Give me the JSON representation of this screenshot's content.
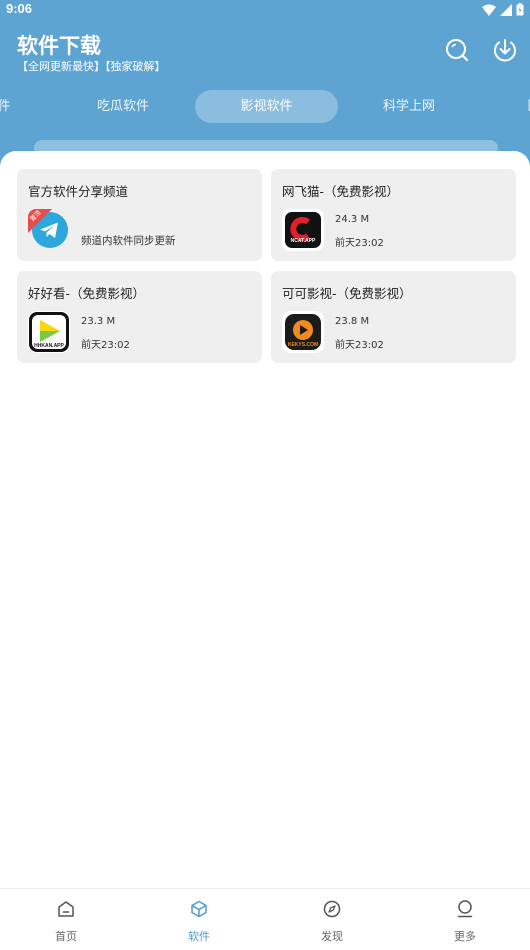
{
  "status_bar": {
    "time": "9:06"
  },
  "header": {
    "title": "软件下载",
    "subtitle": "【全网更新最快】【独家破解】"
  },
  "tabs": [
    {
      "label": "件"
    },
    {
      "label": "吃瓜软件"
    },
    {
      "label": "影视软件"
    },
    {
      "label": "科学上网"
    },
    {
      "label": "同"
    }
  ],
  "cards": [
    {
      "name": "官方软件分享频道",
      "badge": "置顶",
      "description": "频道内软件同步更新",
      "icon": "telegram-icon"
    },
    {
      "name": "网飞猫-（免费影视）",
      "size": "24.3 M",
      "date": "前天23:02",
      "icon_text": "NCAT.APP",
      "icon": "ncat-app-icon"
    },
    {
      "name": "好好看-（免费影视）",
      "size": "23.3 M",
      "date": "前天23:02",
      "icon_text": "HHKAN.APP",
      "icon": "hhkan-app-icon"
    },
    {
      "name": "可可影视-（免费影视）",
      "size": "23.8 M",
      "date": "前天23:02",
      "icon_text": "KEKYS.COM",
      "icon": "kekys-app-icon"
    }
  ],
  "bottom_nav": [
    {
      "label": "首页",
      "icon": "home-icon"
    },
    {
      "label": "软件",
      "icon": "box-icon"
    },
    {
      "label": "发现",
      "icon": "compass-icon"
    },
    {
      "label": "更多",
      "icon": "person-icon"
    }
  ],
  "colors": {
    "header_bg": "#5ea4d2",
    "accent": "#4a9bd4",
    "card_bg": "#efefef"
  }
}
